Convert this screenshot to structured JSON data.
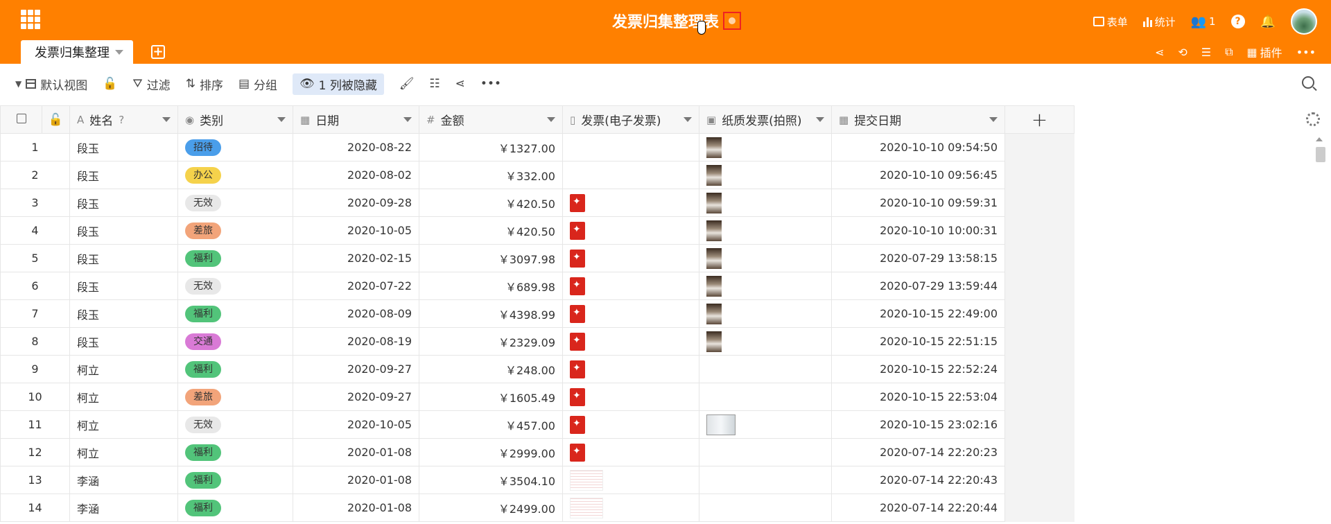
{
  "header": {
    "title": "发票归集整理表",
    "right": [
      {
        "icon": "form-icon",
        "label": "表单"
      },
      {
        "icon": "stats-icon",
        "label": "统计"
      },
      {
        "icon": "users-icon",
        "label": "1"
      }
    ]
  },
  "tabs": [
    {
      "label": "发票归集整理"
    }
  ],
  "header2": {
    "plugins_label": "插件"
  },
  "toolbar": {
    "view_label": "默认视图",
    "filter_label": "过滤",
    "sort_label": "排序",
    "group_label": "分组",
    "hidden_label": "1 列被隐藏"
  },
  "columns": [
    "姓名",
    "类别",
    "日期",
    "金额",
    "发票(电子发票)",
    "纸质发票(拍照)",
    "提交日期"
  ],
  "colors": {
    "header": "#ff8000",
    "招待": "#4a9eea",
    "办公": "#f5d24b",
    "无效": "#e8e8e8",
    "差旅": "#f2a47a",
    "福利": "#52c47a",
    "交通": "#d97ad6"
  },
  "rows": [
    {
      "num": "1",
      "name": "段玉",
      "category": "招待",
      "date": "2020-08-22",
      "amount": "￥1327.00",
      "einvoice": "",
      "photo": "tall",
      "submitted": "2020-10-10 09:54:50"
    },
    {
      "num": "2",
      "name": "段玉",
      "category": "办公",
      "date": "2020-08-02",
      "amount": "￥332.00",
      "einvoice": "",
      "photo": "tall",
      "submitted": "2020-10-10 09:56:45"
    },
    {
      "num": "3",
      "name": "段玉",
      "category": "无效",
      "date": "2020-09-28",
      "amount": "￥420.50",
      "einvoice": "pdf",
      "photo": "tall",
      "submitted": "2020-10-10 09:59:31"
    },
    {
      "num": "4",
      "name": "段玉",
      "category": "差旅",
      "date": "2020-10-05",
      "amount": "￥420.50",
      "einvoice": "pdf",
      "photo": "tall",
      "submitted": "2020-10-10 10:00:31"
    },
    {
      "num": "5",
      "name": "段玉",
      "category": "福利",
      "date": "2020-02-15",
      "amount": "￥3097.98",
      "einvoice": "pdf",
      "photo": "tall",
      "submitted": "2020-07-29 13:58:15"
    },
    {
      "num": "6",
      "name": "段玉",
      "category": "无效",
      "date": "2020-07-22",
      "amount": "￥689.98",
      "einvoice": "pdf",
      "photo": "tall",
      "submitted": "2020-07-29 13:59:44"
    },
    {
      "num": "7",
      "name": "段玉",
      "category": "福利",
      "date": "2020-08-09",
      "amount": "￥4398.99",
      "einvoice": "pdf",
      "photo": "tall",
      "submitted": "2020-10-15 22:49:00"
    },
    {
      "num": "8",
      "name": "段玉",
      "category": "交通",
      "date": "2020-08-19",
      "amount": "￥2329.09",
      "einvoice": "pdf",
      "photo": "tall",
      "submitted": "2020-10-15 22:51:15"
    },
    {
      "num": "9",
      "name": "柯立",
      "category": "福利",
      "date": "2020-09-27",
      "amount": "￥248.00",
      "einvoice": "pdf",
      "photo": "",
      "submitted": "2020-10-15 22:52:24"
    },
    {
      "num": "10",
      "name": "柯立",
      "category": "差旅",
      "date": "2020-09-27",
      "amount": "￥1605.49",
      "einvoice": "pdf",
      "photo": "",
      "submitted": "2020-10-15 22:53:04"
    },
    {
      "num": "11",
      "name": "柯立",
      "category": "无效",
      "date": "2020-10-05",
      "amount": "￥457.00",
      "einvoice": "pdf",
      "photo": "wide",
      "submitted": "2020-10-15 23:02:16"
    },
    {
      "num": "12",
      "name": "柯立",
      "category": "福利",
      "date": "2020-01-08",
      "amount": "￥2999.00",
      "einvoice": "pdf",
      "photo": "",
      "submitted": "2020-07-14 22:20:23"
    },
    {
      "num": "13",
      "name": "李涵",
      "category": "福利",
      "date": "2020-01-08",
      "amount": "￥3504.10",
      "einvoice": "scan",
      "photo": "",
      "submitted": "2020-07-14 22:20:43"
    },
    {
      "num": "14",
      "name": "李涵",
      "category": "福利",
      "date": "2020-01-08",
      "amount": "￥2499.00",
      "einvoice": "scan",
      "photo": "",
      "submitted": "2020-07-14 22:20:44"
    }
  ]
}
